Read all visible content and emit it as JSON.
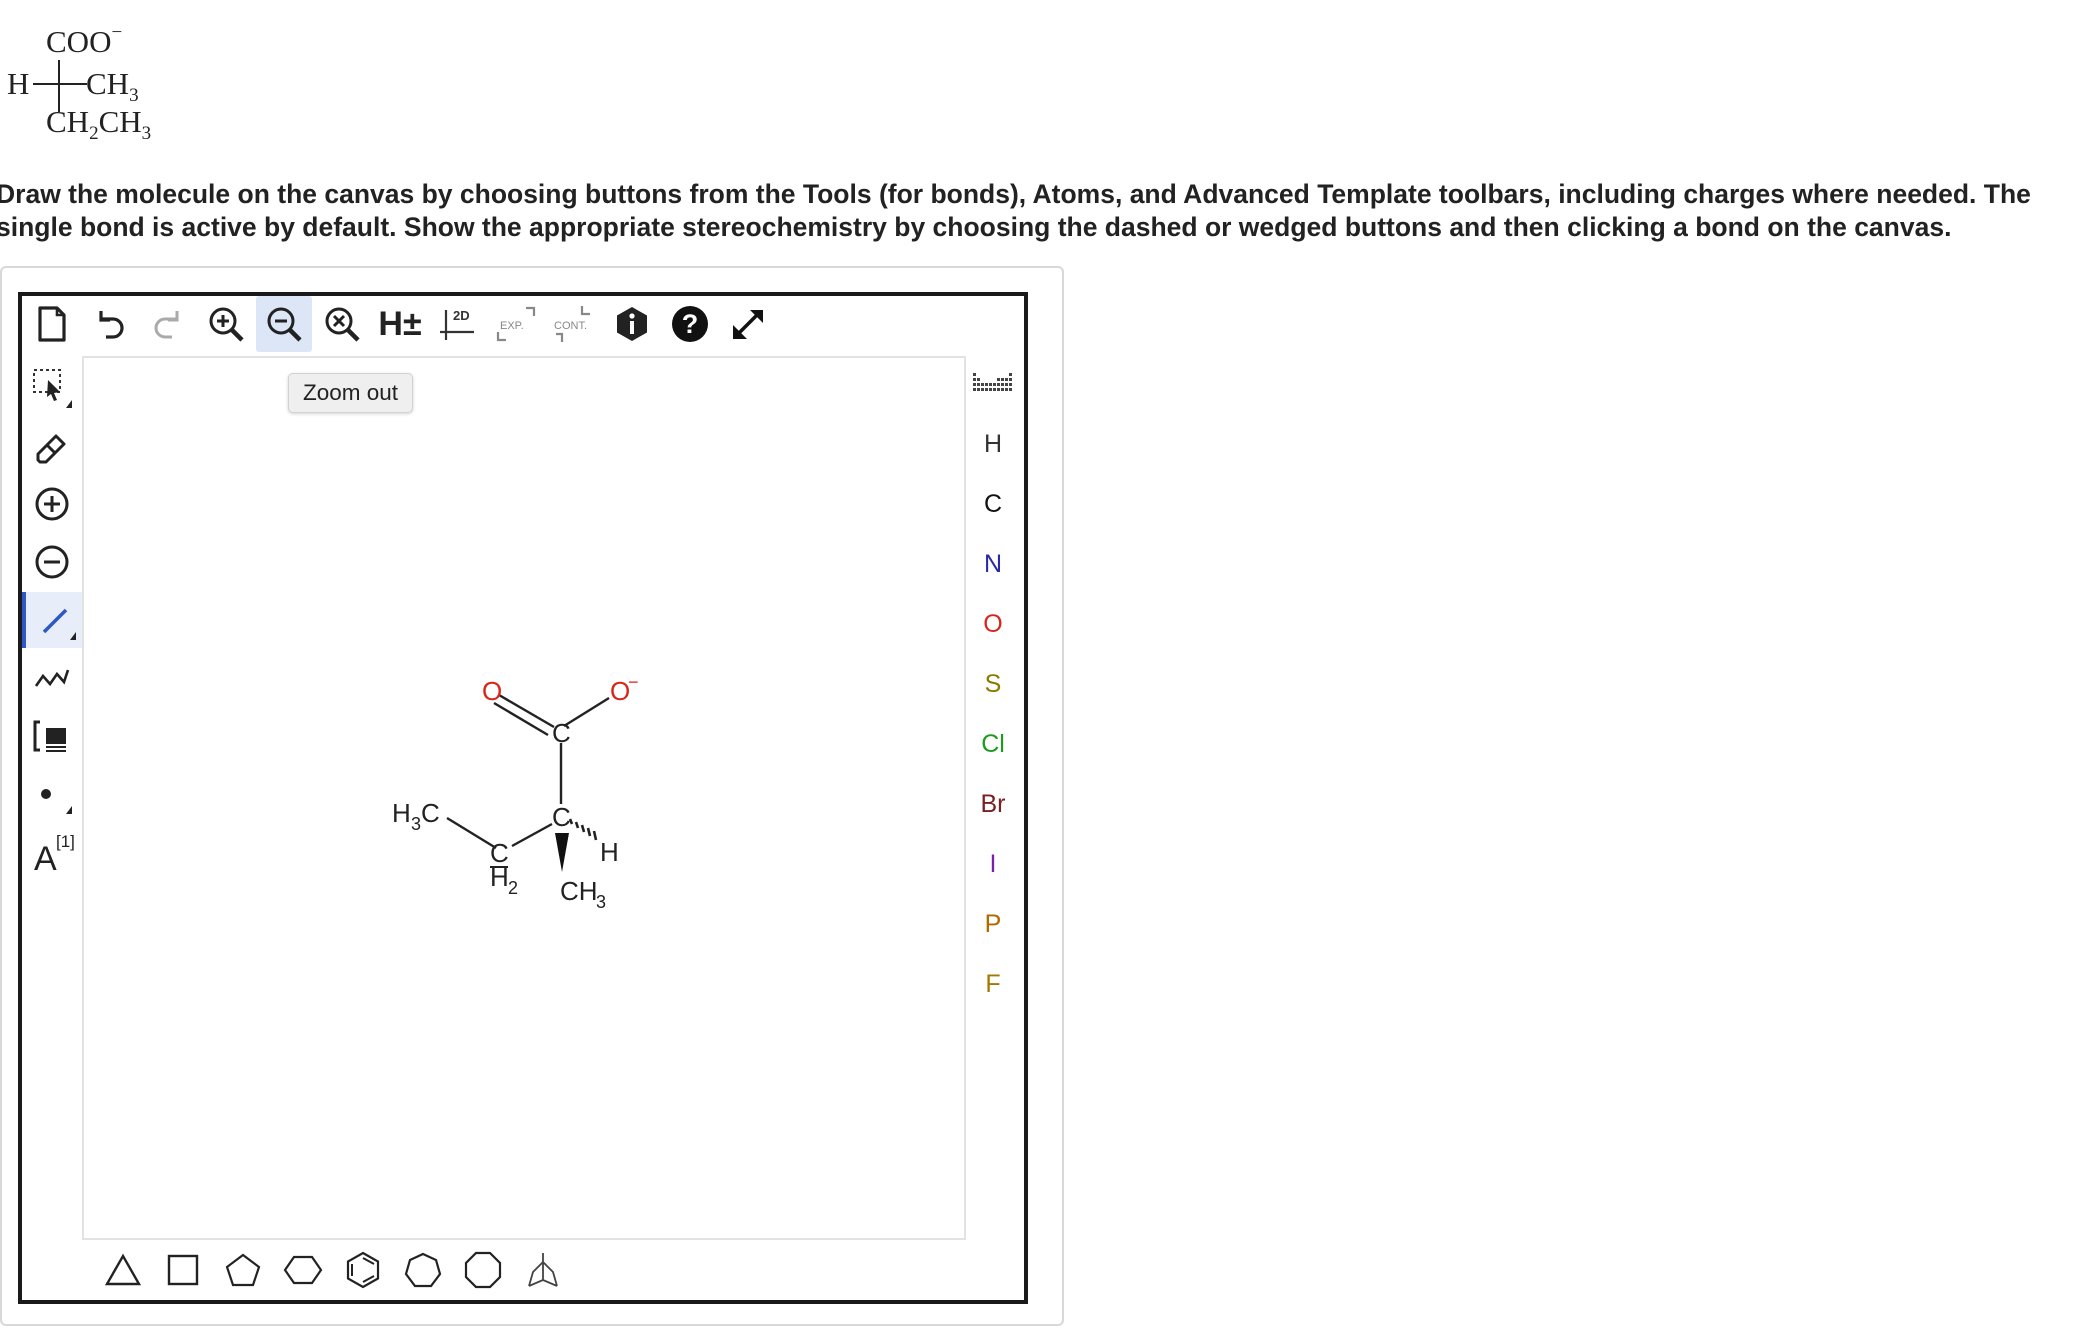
{
  "fischer": {
    "top": "COO",
    "top_charge": "−",
    "left": "H",
    "right_main": "CH",
    "right_sub": "3",
    "bottom_a": "CH",
    "bottom_a_sub": "2",
    "bottom_b": "CH",
    "bottom_b_sub": "3"
  },
  "instructions": "Draw the molecule on the canvas by choosing buttons from the Tools (for bonds), Atoms, and Advanced Template toolbars, including charges where needed. The single bond is active by default. Show the appropriate stereochemistry by choosing the dashed or wedged buttons and then clicking a bond on the canvas.",
  "top_toolbar": {
    "hydrogen_label": "H±",
    "layout_label": "2D",
    "expand_label": "EXP.",
    "contract_label": "CONT."
  },
  "left_toolbar": {
    "text_label": "A",
    "text_sup": "[1]"
  },
  "tooltip": "Zoom out",
  "atoms": [
    {
      "symbol": "H",
      "color": "#333333"
    },
    {
      "symbol": "C",
      "color": "#111111"
    },
    {
      "symbol": "N",
      "color": "#2a2aa8"
    },
    {
      "symbol": "O",
      "color": "#d9261c"
    },
    {
      "symbol": "S",
      "color": "#8a7a00"
    },
    {
      "symbol": "Cl",
      "color": "#1f9a1f"
    },
    {
      "symbol": "Br",
      "color": "#7a2020"
    },
    {
      "symbol": "I",
      "color": "#7a1fa8"
    },
    {
      "symbol": "P",
      "color": "#b06a00"
    },
    {
      "symbol": "F",
      "color": "#a07a00"
    }
  ],
  "molecule": {
    "o_double": "O",
    "o_single": "O",
    "o_charge": "−",
    "carboxyl_c": "C",
    "stereo_c": "C",
    "h_label": "H",
    "ch3_label": "CH",
    "ch3_sub": "3",
    "h3c_label": "H",
    "h3c_sub": "3",
    "h3c_c": "C",
    "ch2_c": "C",
    "ch2_h": "H",
    "ch2_sub": "2"
  },
  "colors": {
    "active_accent": "#3157c5",
    "hover_bg": "#dce6f7",
    "oxygen_red": "#d9261c"
  }
}
